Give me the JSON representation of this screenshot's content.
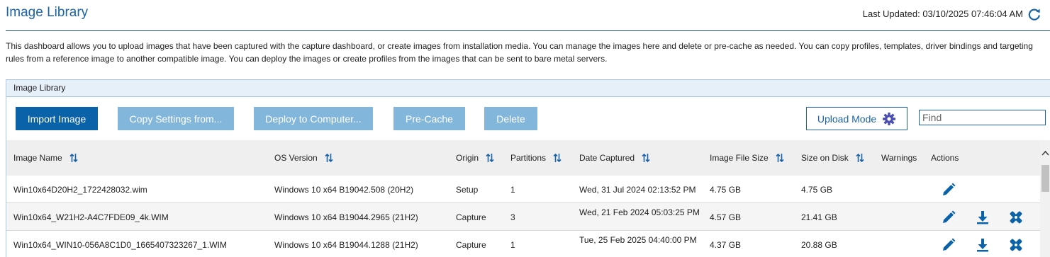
{
  "header": {
    "title": "Image Library",
    "last_updated": "Last Updated: 03/10/2025 07:46:04 AM"
  },
  "description": "This dashboard allows you to upload images that have been captured with the capture dashboard, or create images from installation media. You can manage the images here and delete or pre-cache as needed. You can copy profiles, templates, driver bindings and targeting rules from a reference image to another compatible image. You can deploy the images or create profiles from the images that can be sent to bare metal servers.",
  "panel": {
    "title": "Image Library"
  },
  "toolbar": {
    "import_label": "Import Image",
    "copy_label": "Copy Settings from...",
    "deploy_label": "Deploy to Computer...",
    "precache_label": "Pre-Cache",
    "delete_label": "Delete",
    "upload_mode_label": "Upload Mode",
    "find_placeholder": "Find"
  },
  "columns": {
    "name": "Image Name",
    "os": "OS Version",
    "origin": "Origin",
    "partitions": "Partitions",
    "date": "Date Captured",
    "file_size": "Image File Size",
    "disk_size": "Size on Disk",
    "warnings": "Warnings",
    "actions": "Actions"
  },
  "rows": [
    {
      "name": "Win10x64D20H2_1722428032.wim",
      "os": "Windows 10 x64 B19042.508 (20H2)",
      "origin": "Setup",
      "partitions": "1",
      "date": "Wed, 31 Jul 2024 02:13:52 PM",
      "file_size": "4.75 GB",
      "disk_size": "4.75 GB"
    },
    {
      "name": "Win10x64_W21H2-A4C7FDE09_4k.WIM",
      "os": "Windows 10 x64 B19044.2965 (21H2)",
      "origin": "Capture",
      "partitions": "3",
      "date": "Wed, 21 Feb 2024 05:03:25 PM",
      "file_size": "4.57 GB",
      "disk_size": "21.41 GB"
    },
    {
      "name": "Win10x64_WIN10-056A8C1D0_1665407323267_1.WIM",
      "os": "Windows 10 x64 B19044.1288 (21H2)",
      "origin": "Capture",
      "partitions": "1",
      "date": "Tue, 25 Feb 2025 04:40:00 PM",
      "file_size": "4.37 GB",
      "disk_size": "20.88 GB"
    }
  ],
  "icons": {
    "refresh": "refresh-icon",
    "settings": "gear-icon",
    "sort": "sort-icon",
    "edit": "pencil-icon",
    "download": "download-icon",
    "deploy": "tools-icon"
  },
  "colors": {
    "accent": "#0a63a8",
    "disabled": "#83b6db",
    "panel_header": "#e6f0f9"
  }
}
